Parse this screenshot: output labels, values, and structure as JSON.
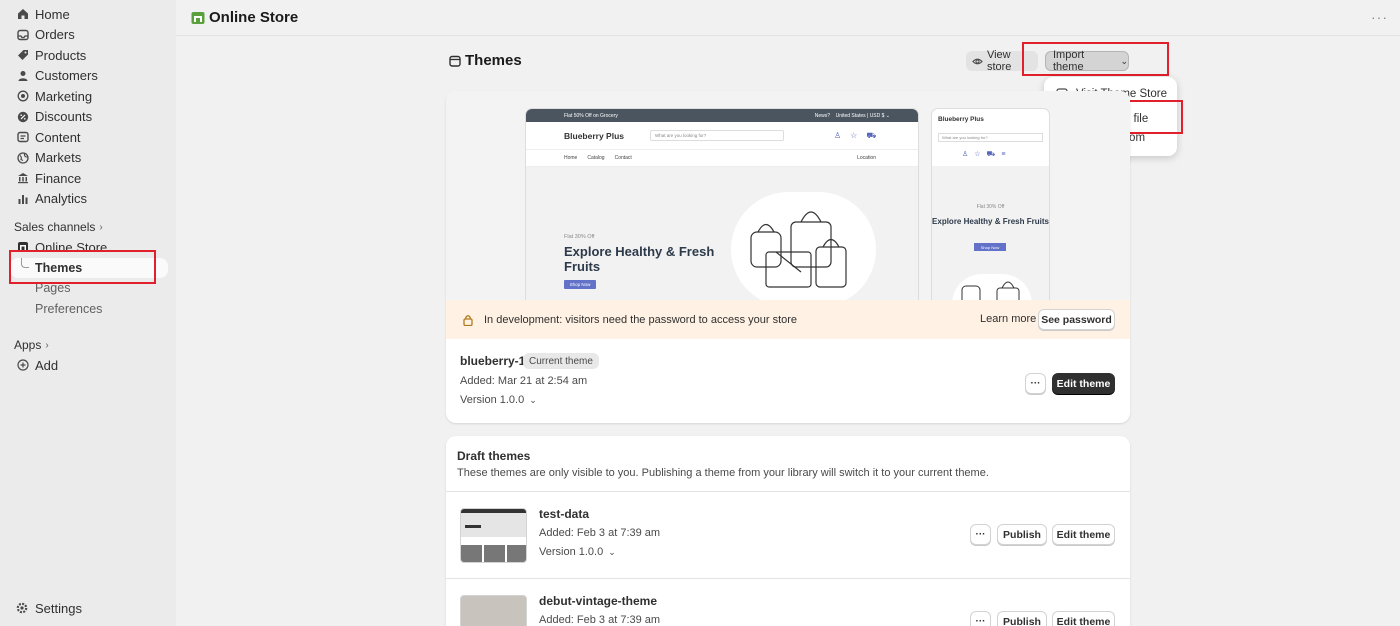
{
  "sidebar": {
    "items": [
      {
        "label": "Home",
        "icon": "home-icon"
      },
      {
        "label": "Orders",
        "icon": "inbox-icon"
      },
      {
        "label": "Products",
        "icon": "tag-icon"
      },
      {
        "label": "Customers",
        "icon": "person-icon"
      },
      {
        "label": "Marketing",
        "icon": "target-icon"
      },
      {
        "label": "Discounts",
        "icon": "discount-icon"
      },
      {
        "label": "Content",
        "icon": "content-icon"
      },
      {
        "label": "Markets",
        "icon": "globe-icon"
      },
      {
        "label": "Finance",
        "icon": "bank-icon"
      },
      {
        "label": "Analytics",
        "icon": "bar-chart-icon"
      }
    ],
    "sales_channels_label": "Sales channels",
    "online_store_label": "Online Store",
    "sub_items": [
      "Themes",
      "Pages",
      "Preferences"
    ],
    "apps_label": "Apps",
    "add_label": "Add",
    "settings_label": "Settings"
  },
  "topbar": {
    "title": "Online Store",
    "more": "···"
  },
  "page": {
    "title": "Themes",
    "view_store_label": "View store",
    "import_theme_label": "Import theme"
  },
  "dropdown": {
    "items": [
      "Visit Theme Store",
      "Upload zip file",
      "Connect from GitHub"
    ]
  },
  "preview": {
    "desktop": {
      "promo": "Flat 50% Off on Grocery",
      "news": "News?",
      "region": "United States | USD $ ⌄",
      "logo": "Blueberry Plus",
      "search_placeholder": "What are you looking for?",
      "nav": [
        "Home",
        "Catalog",
        "Contact"
      ],
      "location": "Location",
      "tag": "Flat 30% Off",
      "headline": "Explore Healthy & Fresh Fruits",
      "shop": "Shop Now"
    },
    "mobile": {
      "logo": "Blueberry Plus",
      "search_placeholder": "What are you looking for?",
      "tag": "Flat 30% Off",
      "headline": "Explore Healthy & Fresh Fruits",
      "shop": "Shop Now"
    }
  },
  "banner": {
    "text": "In development: visitors need the password to access your store",
    "learn_more": "Learn more",
    "see_password": "See password"
  },
  "current_theme": {
    "name": "blueberry-1",
    "badge": "Current theme",
    "added": "Added: Mar 21 at 2:54 am",
    "version": "Version 1.0.0",
    "more": "···",
    "edit_label": "Edit theme"
  },
  "drafts": {
    "title": "Draft themes",
    "description": "These themes are only visible to you. Publishing a theme from your library will switch it to your current theme.",
    "items": [
      {
        "name": "test-data",
        "added": "Added: Feb 3 at 7:39 am",
        "version": "Version 1.0.0",
        "more": "···",
        "publish": "Publish",
        "edit": "Edit theme"
      },
      {
        "name": "debut-vintage-theme",
        "added": "Added: Feb 3 at 7:39 am",
        "more": "···",
        "publish": "Publish",
        "edit": "Edit theme"
      }
    ]
  },
  "colors": {
    "highlight": "#e2202c",
    "primary_button": "#303030",
    "banner_bg": "#fff1e3",
    "store_icon": "#5aa03c"
  }
}
